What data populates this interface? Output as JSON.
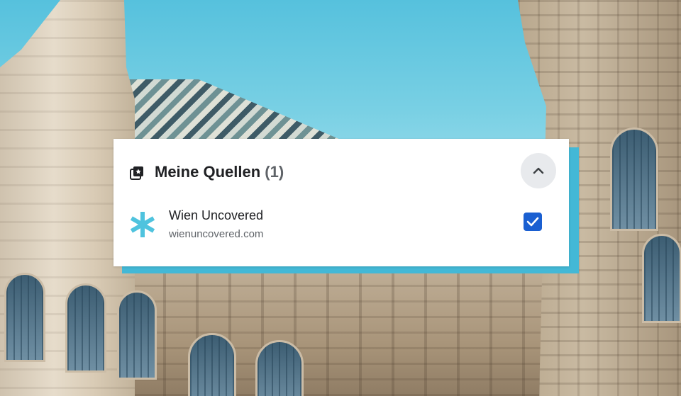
{
  "panel": {
    "title": "Meine Quellen",
    "count": "(1)",
    "header_icon": "collection-icon",
    "collapse_icon": "chevron-up-icon"
  },
  "sources": [
    {
      "name": "Wien Uncovered",
      "url": "wienuncovered.com",
      "logo_icon": "asterisk-logo-icon",
      "checked": true
    }
  ],
  "colors": {
    "accent_cyan": "#43b8d6",
    "checkbox_blue": "#1a5fd1",
    "logo_cyan": "#4fc3de",
    "title_text": "#202124",
    "secondary_text": "#5f6368"
  }
}
